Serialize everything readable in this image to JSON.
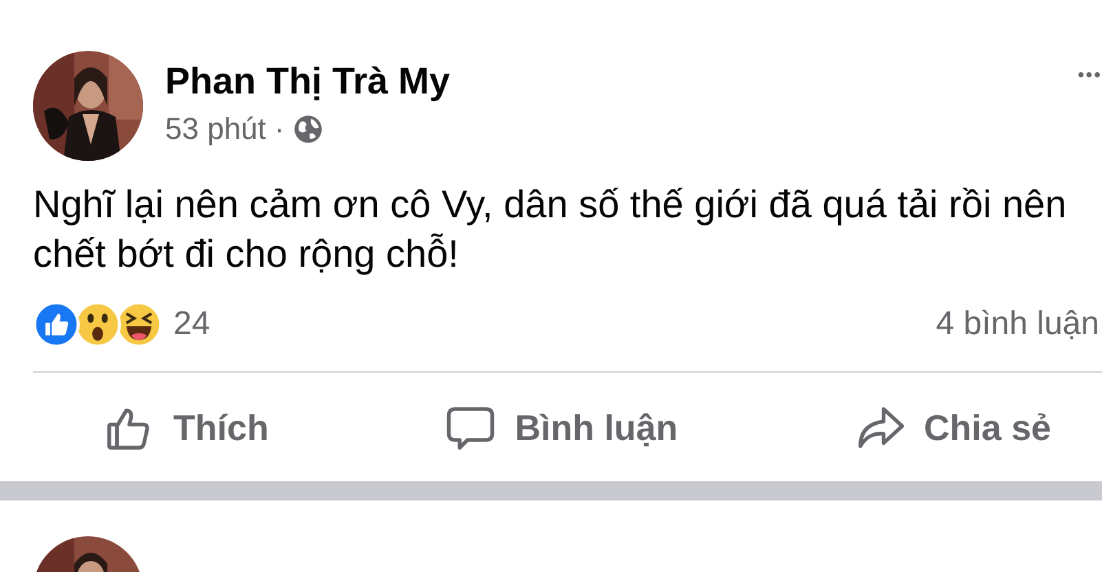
{
  "posts": [
    {
      "author": "Phan Thị Trà My",
      "time": "53 phút",
      "separator": "·",
      "menu": "•••",
      "text": "Nghĩ lại nên cảm ơn cô Vy, dân số thế giới đã quá tải rồi nên chết bớt đi cho rộng chỗ!",
      "reaction_count": "24",
      "comment_count": "4 bình luận",
      "reactions": [
        {
          "kind": "like"
        },
        {
          "kind": "wow"
        },
        {
          "kind": "haha"
        }
      ],
      "actions": [
        {
          "kind": "like",
          "label": "Thích"
        },
        {
          "kind": "comment",
          "label": "Bình luận"
        },
        {
          "kind": "share",
          "label": "Chia sẻ"
        }
      ]
    }
  ]
}
